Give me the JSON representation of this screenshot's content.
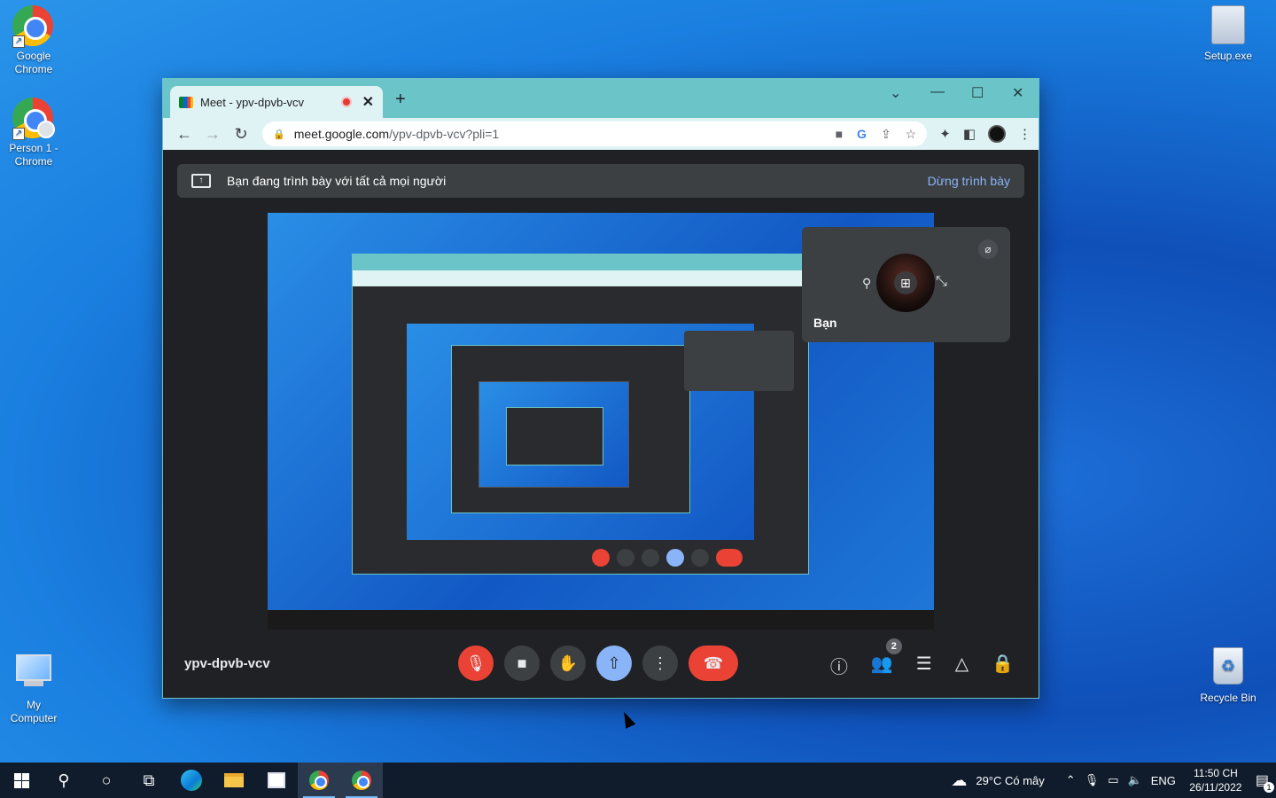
{
  "desktop": {
    "icons_left": [
      {
        "label": "Google\nChrome"
      },
      {
        "label": "Person 1 -\nChrome"
      },
      {
        "label": "My\nComputer"
      }
    ],
    "icons_right": [
      {
        "label": "Setup.exe"
      },
      {
        "label": "Recycle Bin"
      }
    ]
  },
  "browser": {
    "tab_title": "Meet - ypv-dpvb-vcv",
    "url_host": "meet.google.com",
    "url_path": "/ypv-dpvb-vcv?pli=1",
    "new_tab": "+",
    "close_tab": "✕"
  },
  "meet": {
    "present_banner": "Bạn đang trình bày với tất cả mọi người",
    "stop_presenting": "Dừng trình bày",
    "self_name": "Bạn",
    "meeting_code": "ypv-dpvb-vcv",
    "participants_count": "2"
  },
  "taskbar": {
    "weather": "29°C  Có mây",
    "lang": "ENG",
    "time": "11:50 CH",
    "date": "26/11/2022",
    "notif_count": "1"
  },
  "colors": {
    "accent": "#8ab4f8",
    "danger": "#ea4335",
    "tab_bar": "#6bc4c8",
    "meet_bg": "#202124"
  }
}
